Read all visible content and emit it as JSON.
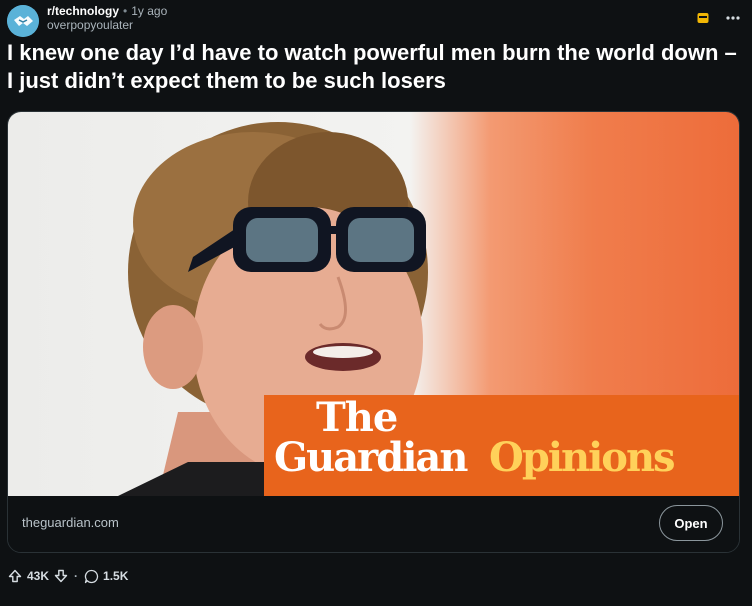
{
  "post": {
    "subreddit": "r/technology",
    "separator": "•",
    "time": "1y ago",
    "author": "overpopyoulater",
    "title": "I knew one day I’d have to watch powerful men burn the world down – I just didn’t expect them to be such losers"
  },
  "link_preview": {
    "domain": "theguardian.com",
    "open_label": "Open",
    "logo": {
      "line1": "The",
      "line2": "Guardian",
      "line3": "Opinions"
    }
  },
  "actions": {
    "upvotes": "43K",
    "vote_separator": "·",
    "comments": "1.5K"
  },
  "icons": {
    "avatar": "subreddit-avatar-icon",
    "award": "award-icon",
    "more": "more-options-icon",
    "upvote": "upvote-icon",
    "downvote": "downvote-icon",
    "comment": "comment-icon"
  },
  "colors": {
    "background": "#0e1113",
    "title": "#ffffff",
    "guardian_orange": "#e8641c",
    "opinions_yellow": "#ffd15a",
    "award_gold": "#f2b705"
  }
}
